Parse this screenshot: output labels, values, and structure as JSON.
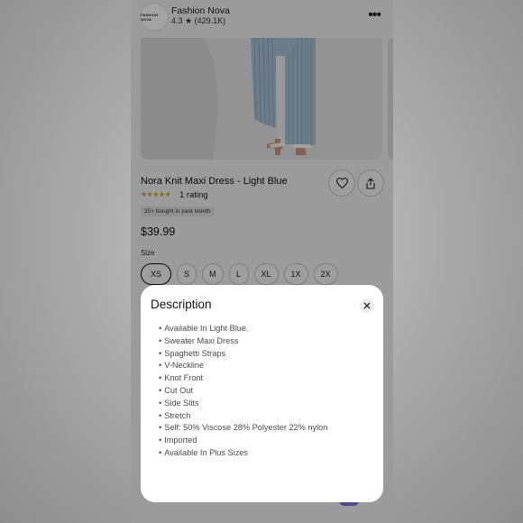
{
  "store": {
    "logo_text": "FASHION NOVA",
    "name": "Fashion Nova",
    "rating": "4.3 ★ (429.1K)"
  },
  "product": {
    "title": "Nora Knit Maxi Dress - Light Blue",
    "stars": "★★★★★",
    "rating_count": "1 rating",
    "badge": "25+ bought in past month",
    "price": "$39.99",
    "size_label": "Size",
    "sizes": [
      "XS",
      "S",
      "M",
      "L",
      "XL",
      "1X",
      "2X"
    ],
    "selected_size": "XS"
  },
  "icons": {
    "more": "more-options-icon",
    "heart": "heart-icon",
    "share": "share-icon",
    "close": "close-icon"
  },
  "description": {
    "title": "Description",
    "items": [
      "Available In Light Blue.",
      "Sweater Maxi Dress",
      "Spaghetti Straps",
      "V-Neckline",
      "Knot Front",
      "Cut Out",
      "Side Slits",
      "Stretch",
      "Self: 50% Viscose 28% Polyester 22% nylon",
      "Imported",
      "Available In Plus Sizes"
    ]
  },
  "colors": {
    "star": "#c9a227",
    "dress": "#a9c2d6"
  }
}
